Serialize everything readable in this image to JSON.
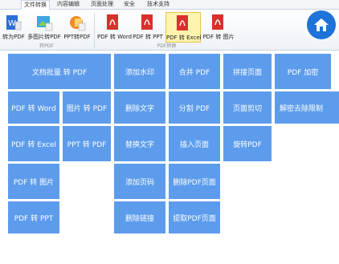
{
  "tabs": [
    {
      "label": "文件转换",
      "active": true
    },
    {
      "label": "内容编辑",
      "active": false
    },
    {
      "label": "页面处理",
      "active": false
    },
    {
      "label": "安全",
      "active": false
    },
    {
      "label": "技术支持",
      "active": false
    }
  ],
  "ribbon": {
    "group1": {
      "label": "转PDF",
      "buttons": [
        {
          "label": "转为PDF",
          "icon": "word-to-pdf-icon"
        },
        {
          "label": "多图片转PDF",
          "icon": "images-to-pdf-icon"
        },
        {
          "label": "PPT转PDF",
          "icon": "ppt-to-pdf-icon"
        }
      ]
    },
    "group2": {
      "label": "PDF转换",
      "buttons": [
        {
          "label": "PDF 转 Word",
          "icon": "pdf-to-word-icon",
          "selected": false
        },
        {
          "label": "PDF 转 PPT",
          "icon": "pdf-to-ppt-icon",
          "selected": false
        },
        {
          "label": "PDF 转 Excel",
          "icon": "pdf-to-excel-icon",
          "selected": true
        },
        {
          "label": "PDF 转 图片",
          "icon": "pdf-to-image-icon",
          "selected": false
        }
      ]
    },
    "home_icon": "home-icon"
  },
  "tiles": {
    "doc_batch": "文档批量 转 PDF",
    "watermark": "添加水印",
    "merge": "合并 PDF",
    "stitch": "拼接页面",
    "encrypt": "PDF 加密",
    "pdf_word": "PDF 转 Word",
    "img_pdf": "图片 转 PDF",
    "delete_text": "删除文字",
    "split": "分割 PDF",
    "crop": "页面剪切",
    "decrypt": "解密去除限制",
    "pdf_excel": "PDF 转 Excel",
    "ppt_pdf": "PPT 转 PDF",
    "replace_text": "替换文字",
    "insert_page": "插入页面",
    "rotate": "旋转PDF",
    "pdf_img": "PDF 转 图片",
    "page_number": "添加页码",
    "delete_page": "删除PDF页面",
    "pdf_ppt": "PDF 转 PPT",
    "delete_link": "删除链接",
    "extract_page": "提取PDF页面"
  },
  "colors": {
    "tile": "#5d9cec",
    "home": "#1e73d8",
    "selected": "#fff3b0"
  }
}
